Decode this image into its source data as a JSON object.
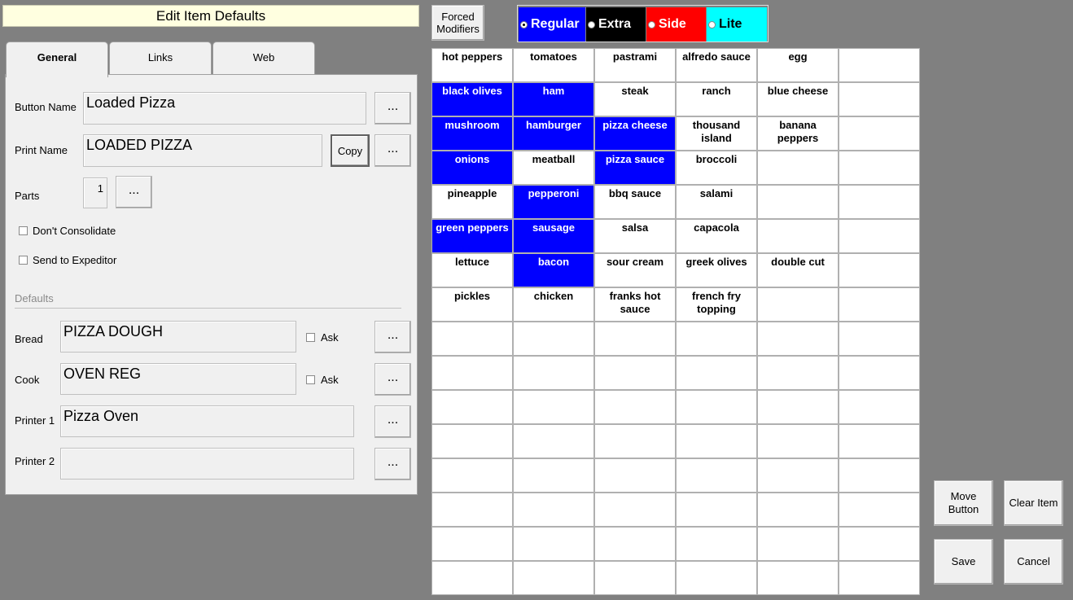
{
  "title": "Edit Item Defaults",
  "tabs": [
    "General",
    "Links",
    "Web"
  ],
  "general": {
    "button_name_label": "Button Name",
    "button_name_value": "Loaded Pizza",
    "print_name_label": "Print Name",
    "print_name_value": "LOADED PIZZA",
    "copy_label": "Copy",
    "parts_label": "Parts",
    "parts_value": "1",
    "dont_consolidate_label": "Don't Consolidate",
    "send_to_expeditor_label": "Send to Expeditor",
    "defaults_label": "Defaults",
    "bread_label": "Bread",
    "bread_value": "PIZZA DOUGH",
    "cook_label": "Cook",
    "cook_value": "OVEN REG",
    "ask_label": "Ask",
    "printer1_label": "Printer 1",
    "printer1_value": "Pizza Oven",
    "printer2_label": "Printer 2",
    "printer2_value": "",
    "dots_label": "..."
  },
  "forced_modifiers_label": "Forced Modifiers",
  "modifiers": [
    {
      "label": "Regular",
      "bg": "#0000ff",
      "fg": "#ffffff",
      "selected": true
    },
    {
      "label": "Extra",
      "bg": "#000000",
      "fg": "#ffffff",
      "selected": false
    },
    {
      "label": "Side",
      "bg": "#ff0000",
      "fg": "#ffffff",
      "selected": false
    },
    {
      "label": "Lite",
      "bg": "#00ffff",
      "fg": "#000000",
      "selected": false
    }
  ],
  "grid_rows": [
    [
      {
        "t": "hot peppers"
      },
      {
        "t": "tomatoes"
      },
      {
        "t": "pastrami"
      },
      {
        "t": "alfredo sauce"
      },
      {
        "t": "egg"
      },
      {
        "t": ""
      }
    ],
    [
      {
        "t": "black olives",
        "s": true
      },
      {
        "t": "ham",
        "s": true
      },
      {
        "t": "steak"
      },
      {
        "t": "ranch"
      },
      {
        "t": "blue cheese"
      },
      {
        "t": ""
      }
    ],
    [
      {
        "t": "mushroom",
        "s": true
      },
      {
        "t": "hamburger",
        "s": true
      },
      {
        "t": "pizza cheese",
        "s": true
      },
      {
        "t": "thousand island"
      },
      {
        "t": "banana peppers"
      },
      {
        "t": ""
      }
    ],
    [
      {
        "t": "onions",
        "s": true
      },
      {
        "t": "meatball"
      },
      {
        "t": "pizza sauce",
        "s": true
      },
      {
        "t": "broccoli"
      },
      {
        "t": ""
      },
      {
        "t": ""
      }
    ],
    [
      {
        "t": "pineapple"
      },
      {
        "t": "pepperoni",
        "s": true
      },
      {
        "t": "bbq sauce"
      },
      {
        "t": "salami"
      },
      {
        "t": ""
      },
      {
        "t": ""
      }
    ],
    [
      {
        "t": "green peppers",
        "s": true
      },
      {
        "t": "sausage",
        "s": true
      },
      {
        "t": "salsa"
      },
      {
        "t": "capacola"
      },
      {
        "t": ""
      },
      {
        "t": ""
      }
    ],
    [
      {
        "t": "lettuce"
      },
      {
        "t": "bacon",
        "s": true
      },
      {
        "t": "sour cream"
      },
      {
        "t": "greek olives"
      },
      {
        "t": "double cut"
      },
      {
        "t": ""
      }
    ],
    [
      {
        "t": "pickles"
      },
      {
        "t": "chicken"
      },
      {
        "t": "franks hot sauce"
      },
      {
        "t": "french fry topping"
      },
      {
        "t": ""
      },
      {
        "t": ""
      }
    ],
    [
      {
        "t": ""
      },
      {
        "t": ""
      },
      {
        "t": ""
      },
      {
        "t": ""
      },
      {
        "t": ""
      },
      {
        "t": ""
      }
    ],
    [
      {
        "t": ""
      },
      {
        "t": ""
      },
      {
        "t": ""
      },
      {
        "t": ""
      },
      {
        "t": ""
      },
      {
        "t": ""
      }
    ],
    [
      {
        "t": ""
      },
      {
        "t": ""
      },
      {
        "t": ""
      },
      {
        "t": ""
      },
      {
        "t": ""
      },
      {
        "t": ""
      }
    ],
    [
      {
        "t": ""
      },
      {
        "t": ""
      },
      {
        "t": ""
      },
      {
        "t": ""
      },
      {
        "t": ""
      },
      {
        "t": ""
      }
    ],
    [
      {
        "t": ""
      },
      {
        "t": ""
      },
      {
        "t": ""
      },
      {
        "t": ""
      },
      {
        "t": ""
      },
      {
        "t": ""
      }
    ],
    [
      {
        "t": ""
      },
      {
        "t": ""
      },
      {
        "t": ""
      },
      {
        "t": ""
      },
      {
        "t": ""
      },
      {
        "t": ""
      }
    ],
    [
      {
        "t": ""
      },
      {
        "t": ""
      },
      {
        "t": ""
      },
      {
        "t": ""
      },
      {
        "t": ""
      },
      {
        "t": ""
      }
    ],
    [
      {
        "t": ""
      },
      {
        "t": ""
      },
      {
        "t": ""
      },
      {
        "t": ""
      },
      {
        "t": ""
      },
      {
        "t": ""
      }
    ]
  ],
  "actions": {
    "move_button": "Move Button",
    "clear_item": "Clear Item",
    "save": "Save",
    "cancel": "Cancel"
  }
}
